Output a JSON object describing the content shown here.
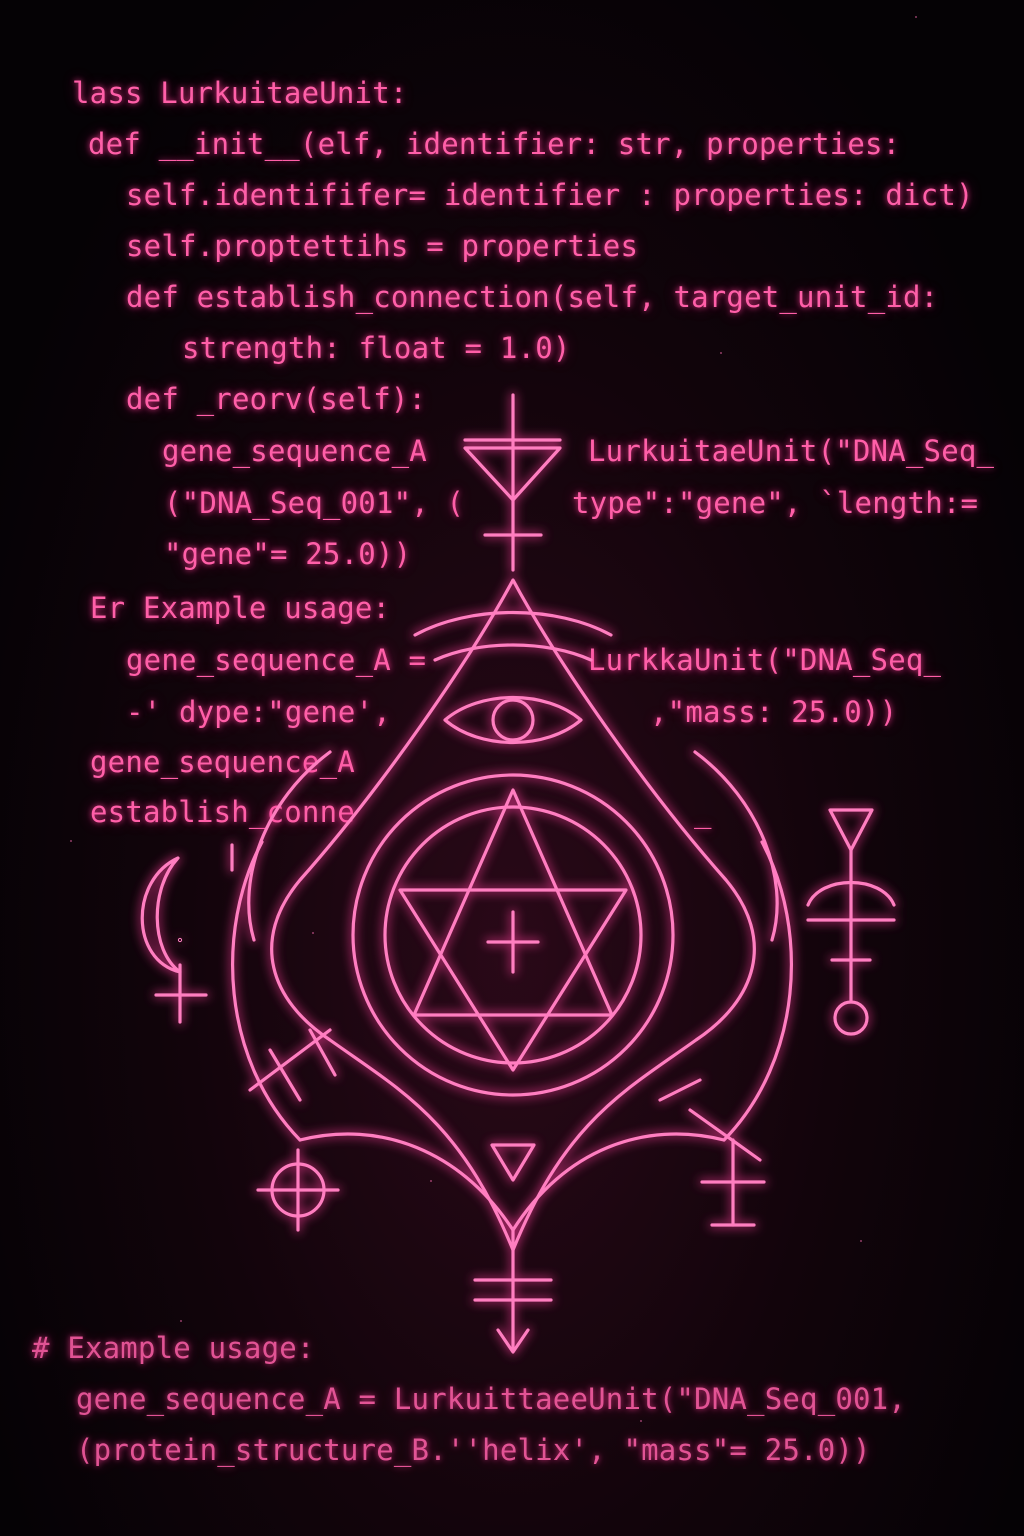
{
  "theme": {
    "code_color": "#ff5fa8",
    "glow_color": "#ff3d9c",
    "background": "#050205"
  },
  "code": {
    "lines": [
      "lass LurkuitaeUnit:",
      "def __init__(elf, identifier: str, properties:",
      "self.identififer= identifier : properties: dict)",
      "self.proptettihs = properties",
      "def establish_connection(self, target_unit_id:",
      "strength: float = 1.0)",
      "def _reorv(self):",
      "gene_sequence_A",
      "LurkuitaeUnit(\"DNA_Seq_",
      "(\"DNA_Seq_001\", (",
      "type\":\"gene\", `length:=",
      "\"gene\"= 25.0))",
      "Er Example usage:",
      "gene_sequence_A =",
      "LurkkaUnit(\"DNA_Seq_",
      "-' dype:\"gene',",
      ",\"mass: 25.0))",
      "gene_sequence_A",
      "establish_conne",
      "_",
      "# Example usage:",
      "gene_sequence_A = LurkuittaeeUnit(\"DNA_Seq_001,",
      "(protein_structure_B.''helix', \"mass\"= 25.0))"
    ]
  },
  "sigil": {
    "icons": [
      "triangle-eye-sigil-icon",
      "crescent-venus-icon",
      "mercury-glyph-icon",
      "sun-cross-icon",
      "cross-icon"
    ]
  }
}
